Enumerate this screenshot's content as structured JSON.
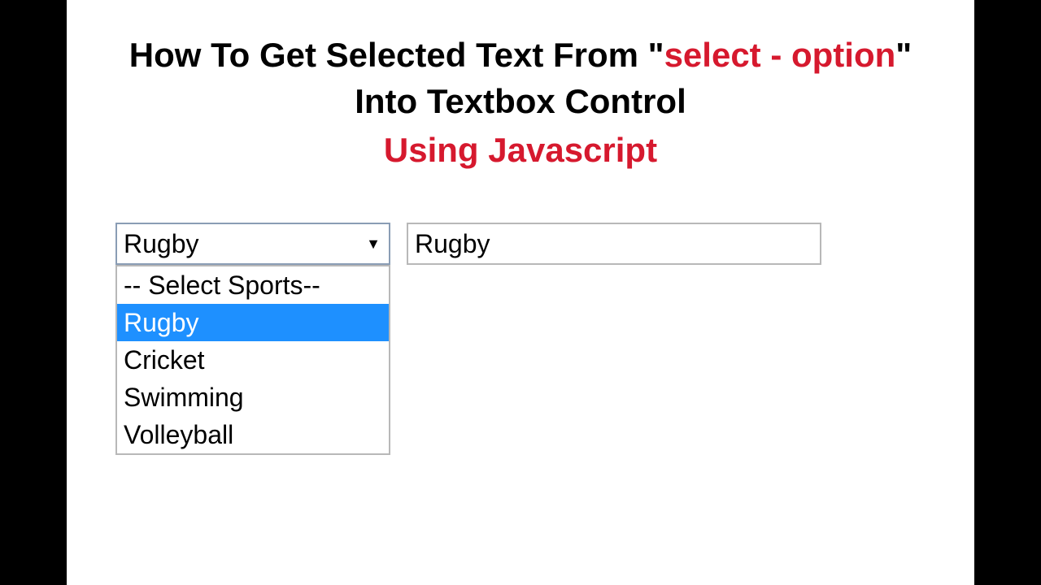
{
  "title": {
    "line1_prefix": "How To Get Selected Text From \"",
    "line1_highlight": "select - option",
    "line1_suffix": "\"",
    "line2": "Into Textbox Control",
    "line3": "Using Javascript"
  },
  "select": {
    "value": "Rugby",
    "options": [
      {
        "label": "-- Select Sports--",
        "selected": false
      },
      {
        "label": "Rugby",
        "selected": true
      },
      {
        "label": "Cricket",
        "selected": false
      },
      {
        "label": "Swimming",
        "selected": false
      },
      {
        "label": "Volleyball",
        "selected": false
      }
    ]
  },
  "textbox": {
    "value": "Rugby"
  },
  "colors": {
    "accent": "#d6192e",
    "highlight_bg": "#1e90ff",
    "select_border": "#8a9db5",
    "input_border": "#b8b8b8"
  }
}
